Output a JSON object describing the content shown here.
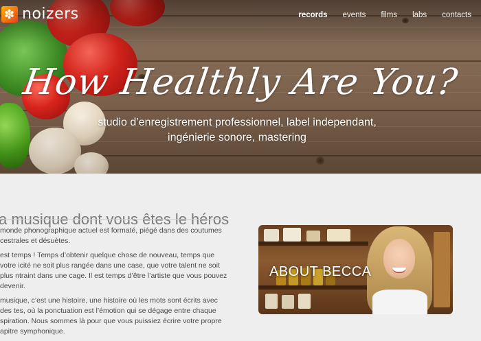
{
  "brand": {
    "name": "noizers"
  },
  "nav": {
    "items": [
      {
        "label": "records",
        "active": true
      },
      {
        "label": "events",
        "active": false
      },
      {
        "label": "films",
        "active": false
      },
      {
        "label": "labs",
        "active": false
      },
      {
        "label": "contacts",
        "active": false
      }
    ]
  },
  "hero": {
    "title": "How Healthly Are You?",
    "subtitle_line1": "studio d’enregistrement professionnel, label independant,",
    "subtitle_line2": "ingénierie sonore, mastering"
  },
  "main": {
    "section_title": "a musique dont vous êtes le héros",
    "paragraphs": [
      " monde phonographique actuel est formaté, piégé dans des coutumes cestrales et désuètes.",
      "est temps ! Temps d’obtenir quelque chose de nouveau, temps que votre icité ne soit plus rangée dans une case, que votre talent ne soit plus ntraint dans une cage. Il est temps d’être l’artiste que vous pouvez devenir.",
      " musique, c’est une histoire, une histoire où les mots sont écrits avec des tes, où la ponctuation est l’émotion qui se dégage entre chaque spiration. Nous sommes là pour que vous puissiez écrire votre propre apitre symphonique."
    ]
  },
  "card": {
    "label": "ABOUT BECCA"
  },
  "colors": {
    "background": "#eeeeee",
    "nav_text": "#ffffff",
    "title_text": "#7a7a7a"
  }
}
